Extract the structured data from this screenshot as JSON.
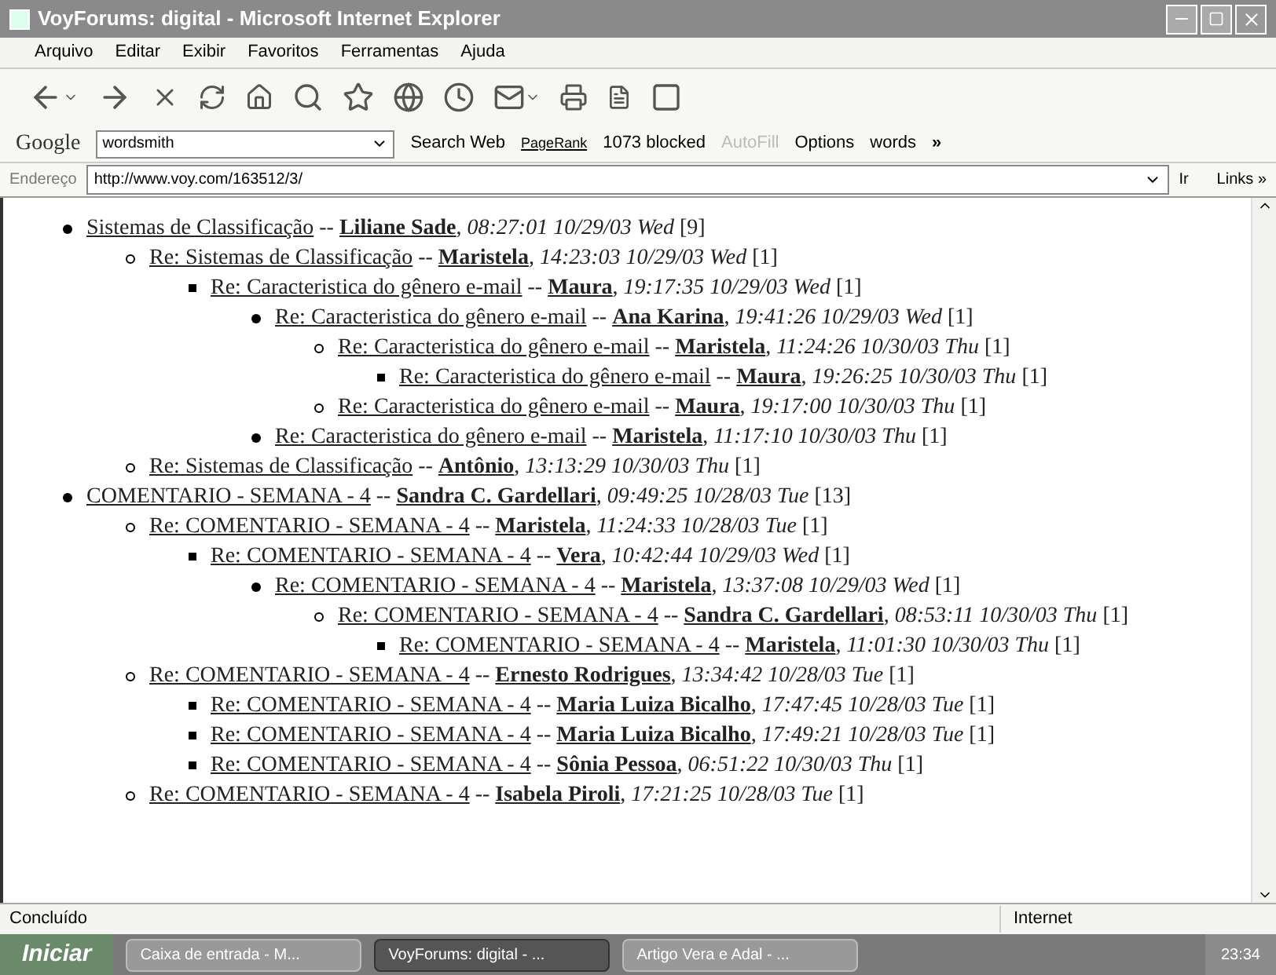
{
  "window": {
    "title": "VoyForums: digital - Microsoft Internet Explorer"
  },
  "menu": [
    "Arquivo",
    "Editar",
    "Exibir",
    "Favoritos",
    "Ferramentas",
    "Ajuda"
  ],
  "google_bar": {
    "logo": "Google",
    "search_value": "wordsmith",
    "search_button": "Search Web",
    "pagerank": "PageRank",
    "blocked": "1073 blocked",
    "autofill": "AutoFill",
    "options": "Options",
    "words": "words",
    "more": "»"
  },
  "address_bar": {
    "label": "Endereço",
    "url": "http://www.voy.com/163512/3/",
    "go": "Ir",
    "links": "Links",
    "more": "»"
  },
  "separator": "--",
  "comma": ",",
  "posts": [
    {
      "subject": "Sistemas de Classificação",
      "author": "Liliane Sade",
      "time": "08:27:01 10/29/03 Wed",
      "count": "[9]",
      "children": [
        {
          "subject": "Re: Sistemas de Classificação",
          "author": "Maristela",
          "time": "14:23:03 10/29/03 Wed",
          "count": "[1]",
          "children": [
            {
              "subject": "Re: Caracteristica do gênero e-mail",
              "author": "Maura",
              "time": "19:17:35 10/29/03 Wed",
              "count": "[1]",
              "children": [
                {
                  "subject": "Re: Caracteristica do gênero e-mail",
                  "author": "Ana Karina",
                  "time": "19:41:26 10/29/03 Wed",
                  "count": "[1]",
                  "children": [
                    {
                      "subject": "Re: Caracteristica do gênero e-mail",
                      "author": "Maristela",
                      "time": "11:24:26 10/30/03 Thu",
                      "count": "[1]",
                      "children": [
                        {
                          "subject": "Re: Caracteristica do gênero e-mail",
                          "author": "Maura",
                          "time": "19:26:25 10/30/03 Thu",
                          "count": "[1]"
                        }
                      ]
                    },
                    {
                      "subject": "Re: Caracteristica do gênero e-mail",
                      "author": "Maura",
                      "time": "19:17:00 10/30/03 Thu",
                      "count": "[1]"
                    }
                  ]
                },
                {
                  "subject": "Re: Caracteristica do gênero e-mail",
                  "author": "Maristela",
                  "time": "11:17:10 10/30/03 Thu",
                  "count": "[1]"
                }
              ]
            }
          ]
        },
        {
          "subject": "Re: Sistemas de Classificação",
          "author": "Antônio",
          "time": "13:13:29 10/30/03 Thu",
          "count": "[1]"
        }
      ]
    },
    {
      "subject": "COMENTARIO - SEMANA - 4",
      "author": "Sandra C. Gardellari",
      "time": "09:49:25 10/28/03 Tue",
      "count": "[13]",
      "children": [
        {
          "subject": "Re: COMENTARIO - SEMANA - 4",
          "author": "Maristela",
          "time": "11:24:33 10/28/03 Tue",
          "count": "[1]",
          "children": [
            {
              "subject": "Re: COMENTARIO - SEMANA - 4",
              "author": "Vera",
              "time": "10:42:44 10/29/03 Wed",
              "count": "[1]",
              "children": [
                {
                  "subject": "Re: COMENTARIO - SEMANA - 4",
                  "author": "Maristela",
                  "time": "13:37:08 10/29/03 Wed",
                  "count": "[1]",
                  "children": [
                    {
                      "subject": "Re: COMENTARIO - SEMANA - 4",
                      "author": "Sandra C. Gardellari",
                      "time": "08:53:11 10/30/03 Thu",
                      "count": "[1]",
                      "children": [
                        {
                          "subject": "Re: COMENTARIO - SEMANA - 4",
                          "author": "Maristela",
                          "time": "11:01:30 10/30/03 Thu",
                          "count": "[1]"
                        }
                      ]
                    }
                  ]
                }
              ]
            }
          ]
        },
        {
          "subject": "Re: COMENTARIO - SEMANA - 4",
          "author": "Ernesto Rodrigues",
          "time": "13:34:42 10/28/03 Tue",
          "count": "[1]",
          "children": [
            {
              "subject": "Re: COMENTARIO - SEMANA - 4",
              "author": "Maria Luiza Bicalho",
              "time": "17:47:45 10/28/03 Tue",
              "count": "[1]"
            },
            {
              "subject": "Re: COMENTARIO - SEMANA - 4",
              "author": "Maria Luiza Bicalho",
              "time": "17:49:21 10/28/03 Tue",
              "count": "[1]"
            },
            {
              "subject": "Re: COMENTARIO - SEMANA - 4",
              "author": "Sônia Pessoa",
              "time": "06:51:22 10/30/03 Thu",
              "count": "[1]"
            }
          ]
        },
        {
          "subject": "Re: COMENTARIO - SEMANA - 4",
          "author": "Isabela Piroli",
          "time": "17:21:25 10/28/03 Tue",
          "count": "[1]"
        }
      ]
    }
  ],
  "status_bar": {
    "text": "Concluído",
    "zone": "Internet"
  },
  "taskbar": {
    "start": "Iniciar",
    "tasks": [
      {
        "label": "Caixa de entrada - M...",
        "selected": false
      },
      {
        "label": "VoyForums: digital - ...",
        "selected": true
      },
      {
        "label": "Artigo Vera e Adal - ...",
        "selected": false
      }
    ],
    "clock": "23:34"
  }
}
